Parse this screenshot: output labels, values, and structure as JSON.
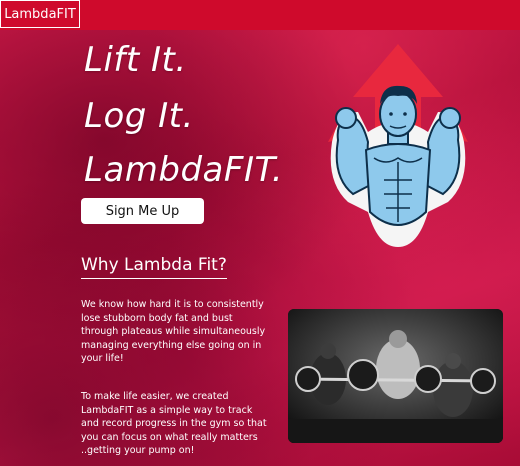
{
  "brand": {
    "name": "LambdaFIT"
  },
  "hero": {
    "lines": [
      "Lift It.",
      "Log It.",
      "LambdaFIT."
    ],
    "cta_label": "Sign Me Up"
  },
  "why": {
    "heading": "Why Lambda Fit?",
    "paragraph1": "We know how hard it is to consistently lose stubborn body fat and bust through plateaus while simultaneously managing everything else going on in your life!",
    "paragraph2": "To make life easier, we created LambdaFIT as a simple way to track and record progress in the gym so that you can focus on what really matters ..getting your pump on!"
  },
  "colors": {
    "brand_red": "#cf0a2c",
    "button_bg": "#ffffff"
  },
  "images": {
    "hero_illustration": "muscle-man-flexing-illustration",
    "gym_photo": "barbell-class-photo"
  }
}
